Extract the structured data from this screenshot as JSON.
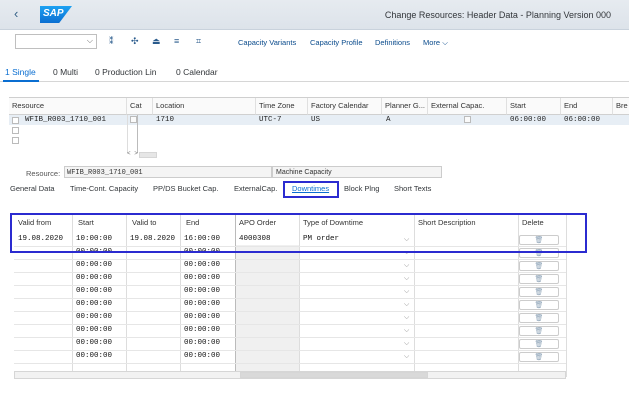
{
  "shell": {
    "title": "Change Resources: Header Data - Planning Version 000",
    "logo": "SAP",
    "back_glyph": "‹"
  },
  "toolbar": {
    "buttons": [
      "Capacity Variants",
      "Capacity Profile",
      "Definitions",
      "More"
    ],
    "more_chevron": "⌵"
  },
  "view_tabs": [
    "1 Single",
    "0 Multi",
    "0 Production Lin",
    "0 Calendar"
  ],
  "resources": {
    "headers": [
      "Resource",
      "Cat",
      "Location",
      "Time Zone",
      "Factory Calendar",
      "Planner G...",
      "External Capac.",
      "Start",
      "End",
      "Bre"
    ],
    "row": {
      "resource": "WFIB_R003_1710_001",
      "location": "1710",
      "time_zone": "UTC-7",
      "factory_calendar": "US",
      "planner_group": "A",
      "start": "06:00:00",
      "end": "06:00:00"
    },
    "scroll_arrows": "< >"
  },
  "resource_detail": {
    "label": "Resource:",
    "value": "WFIB_R003_1710_001",
    "description": "Machine Capacity"
  },
  "detail_tabs": [
    "General Data",
    "Time-Cont. Capacity",
    "PP/DS Bucket Cap.",
    "ExternalCap.",
    "Downtimes",
    "Block Plng",
    "Short Texts"
  ],
  "downtimes": {
    "headers": [
      "Valid from",
      "Start",
      "Valid to",
      "End",
      "APO Order",
      "Type of Downtime",
      "Short Description",
      "Delete"
    ],
    "first_row": {
      "valid_from": "19.08.2020",
      "start": "10:00:00",
      "valid_to": "19.08.2020",
      "end": "16:00:00",
      "apo_order": "4000308",
      "type": "PM order"
    },
    "empty_time": "00:00:00",
    "trash_glyph": "🗑",
    "dropdown_glyph": "⌵"
  },
  "colors": {
    "highlight": "#2b2bd0",
    "accent": "#0a6ed1"
  }
}
